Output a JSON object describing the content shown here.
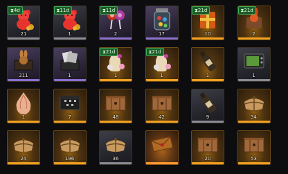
{
  "colors": {
    "rarity_bar": {
      "gray": "#8a8a94",
      "purple": "#8b6fd0",
      "gold": "#f0a020",
      "orange": "#ff9a30"
    },
    "timer_bg": "#1f5a2a"
  },
  "slots": [
    {
      "item": "gummy-bear",
      "icon": "gummy-bear-icon",
      "count": "21",
      "timer": "4d",
      "rarity": "gray"
    },
    {
      "item": "gummy-bear",
      "icon": "gummy-bear-icon",
      "count": "1",
      "timer": "11d",
      "rarity": "gray"
    },
    {
      "item": "lollipops",
      "icon": "lollipop-icon",
      "count": "2",
      "timer": "11d",
      "rarity": "purple"
    },
    {
      "item": "candy-jar",
      "icon": "candy-jar-icon",
      "count": "17",
      "timer": "",
      "rarity": "purple"
    },
    {
      "item": "gift-box-orange",
      "icon": "gift-box-icon",
      "count": "10",
      "timer": "21d",
      "rarity": "gold"
    },
    {
      "item": "bunny-box",
      "icon": "bunny-box-icon",
      "count": "2",
      "timer": "21d",
      "rarity": "gold"
    },
    {
      "item": "bunny-chest",
      "icon": "bunny-chest-icon",
      "count": "211",
      "timer": "",
      "rarity": "purple"
    },
    {
      "item": "photo-chest",
      "icon": "photo-chest-icon",
      "count": "1",
      "timer": "",
      "rarity": "purple"
    },
    {
      "item": "potion-flowers",
      "icon": "potion-icon",
      "count": "1",
      "timer": "21d",
      "rarity": "gold"
    },
    {
      "item": "potion-flowers",
      "icon": "potion-icon",
      "count": "1",
      "timer": "21d",
      "rarity": "gold"
    },
    {
      "item": "bottle",
      "icon": "bottle-icon",
      "count": "1",
      "timer": "",
      "rarity": "gold"
    },
    {
      "item": "tv-set",
      "icon": "tv-icon",
      "count": "1",
      "timer": "",
      "rarity": "gray"
    },
    {
      "item": "onion-orb",
      "icon": "onion-orb-icon",
      "count": "1",
      "timer": "",
      "rarity": "gold"
    },
    {
      "item": "dark-chest",
      "icon": "dark-chest-icon",
      "count": "7",
      "timer": "",
      "rarity": "gold"
    },
    {
      "item": "wooden-crate",
      "icon": "crate-icon",
      "count": "48",
      "timer": "",
      "rarity": "gold"
    },
    {
      "item": "wooden-crate",
      "icon": "crate-icon",
      "count": "42",
      "timer": "",
      "rarity": "gold"
    },
    {
      "item": "bottle",
      "icon": "bottle-icon",
      "count": "9",
      "timer": "",
      "rarity": "gray"
    },
    {
      "item": "parcel",
      "icon": "parcel-icon",
      "count": "34",
      "timer": "",
      "rarity": "gold"
    },
    {
      "item": "parcel",
      "icon": "parcel-icon",
      "count": "24",
      "timer": "",
      "rarity": "gold"
    },
    {
      "item": "parcel",
      "icon": "parcel-icon",
      "count": "196",
      "timer": "",
      "rarity": "gold"
    },
    {
      "item": "parcel",
      "icon": "parcel-icon",
      "count": "36",
      "timer": "",
      "rarity": "gray"
    },
    {
      "item": "envelope",
      "icon": "envelope-icon",
      "count": "",
      "timer": "",
      "rarity": "orange"
    },
    {
      "item": "wooden-crate",
      "icon": "crate-icon",
      "count": "20",
      "timer": "",
      "rarity": "gold"
    },
    {
      "item": "wooden-crate",
      "icon": "crate-icon",
      "count": "53",
      "timer": "",
      "rarity": "gold"
    }
  ]
}
